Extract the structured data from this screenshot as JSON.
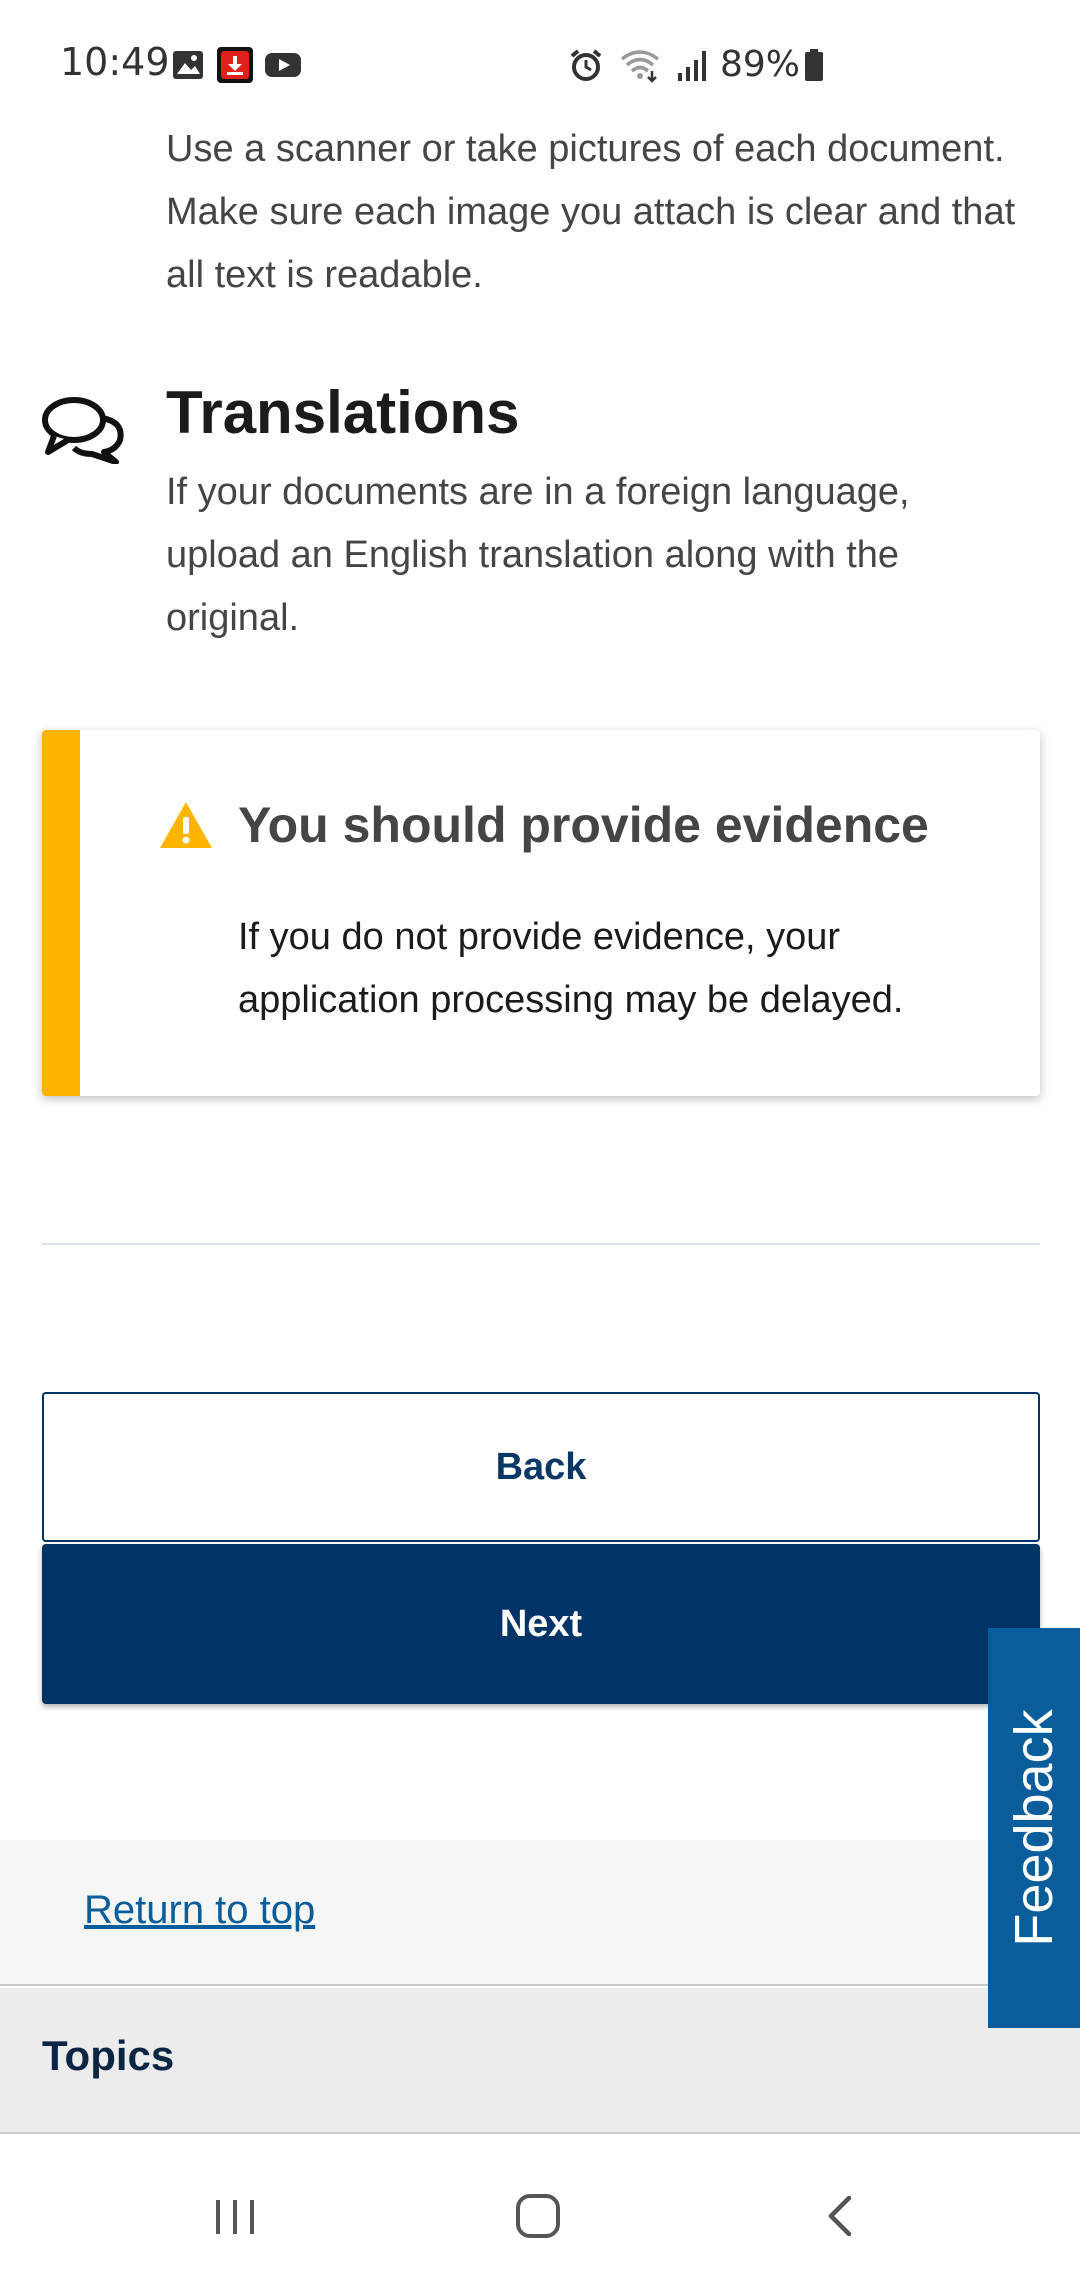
{
  "status_bar": {
    "time": "10:49",
    "battery": "89%",
    "icons": [
      "image-icon",
      "download-icon",
      "youtube-icon",
      "alarm-icon",
      "wifi-icon",
      "signal-icon",
      "battery-icon"
    ]
  },
  "content": {
    "upload_text": "Use a scanner or take pictures of each document. Make sure each image you attach is clear and that all text is readable.",
    "translations": {
      "title": "Translations",
      "text": "If your documents are in a foreign language, upload an English translation along with the original."
    },
    "alert": {
      "title": "You should provide evidence",
      "body": "If you do not provide evidence, your application processing may be delayed.",
      "accent_color": "#ffb500"
    }
  },
  "buttons": {
    "back": "Back",
    "next": "Next"
  },
  "feedback": {
    "label": "Feedback"
  },
  "footer": {
    "return_to_top": "Return to top",
    "topics": "Topics"
  },
  "colors": {
    "primary": "#003366",
    "link": "#0a5d9b",
    "warning": "#ffb500"
  }
}
